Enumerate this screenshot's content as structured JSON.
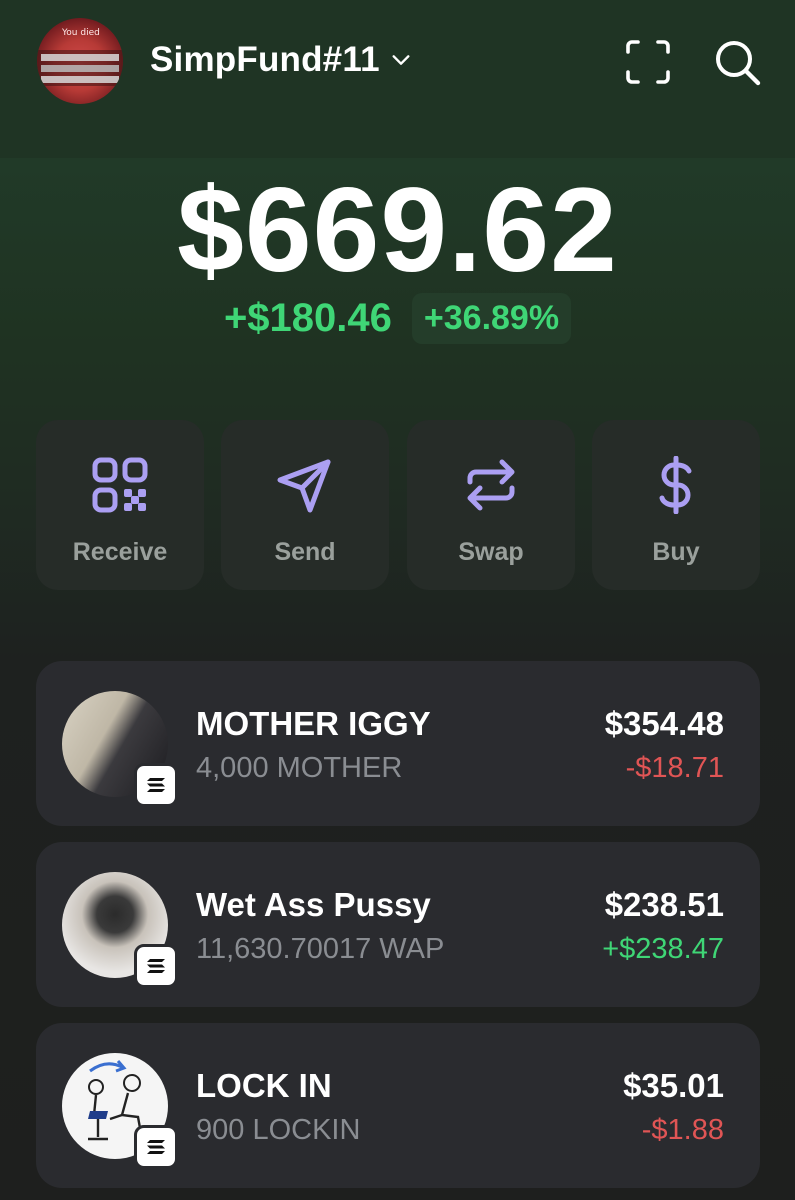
{
  "header": {
    "account_name": "SimpFund#11",
    "avatar_text": "You died"
  },
  "portfolio": {
    "balance": "$669.62",
    "change_amount": "+$180.46",
    "change_percent": "+36.89%"
  },
  "actions": [
    {
      "label": "Receive",
      "icon": "qr-code-icon"
    },
    {
      "label": "Send",
      "icon": "paper-plane-icon"
    },
    {
      "label": "Swap",
      "icon": "swap-arrows-icon"
    },
    {
      "label": "Buy",
      "icon": "dollar-icon"
    }
  ],
  "tokens": [
    {
      "name": "MOTHER IGGY",
      "quantity": "4,000 MOTHER",
      "value": "$354.48",
      "change": "-$18.71",
      "change_dir": "neg"
    },
    {
      "name": "Wet Ass Pussy",
      "quantity": "11,630.70017 WAP",
      "value": "$238.51",
      "change": "+$238.47",
      "change_dir": "pos"
    },
    {
      "name": "LOCK IN",
      "quantity": "900 LOCKIN",
      "value": "$35.01",
      "change": "-$1.88",
      "change_dir": "neg"
    }
  ],
  "colors": {
    "accent": "#ab9ff2",
    "positive": "#3fd676",
    "negative": "#e05555"
  }
}
